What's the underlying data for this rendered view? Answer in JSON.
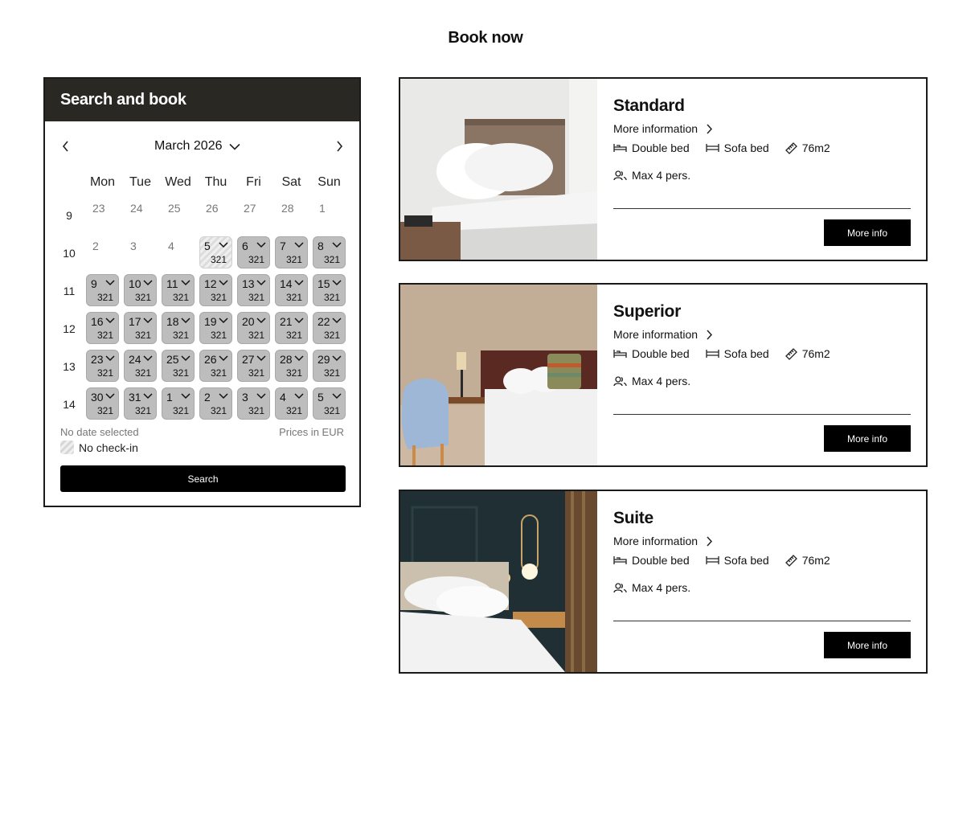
{
  "page": {
    "title": "Book now"
  },
  "widget": {
    "title": "Search and book",
    "month": "March 2026",
    "weekdays": [
      "Mon",
      "Tue",
      "Wed",
      "Thu",
      "Fri",
      "Sat",
      "Sun"
    ],
    "weeks": [
      {
        "num": "9",
        "days": [
          {
            "d": "23",
            "state": "plain"
          },
          {
            "d": "24",
            "state": "plain"
          },
          {
            "d": "25",
            "state": "plain"
          },
          {
            "d": "26",
            "state": "plain"
          },
          {
            "d": "27",
            "state": "plain"
          },
          {
            "d": "28",
            "state": "plain"
          },
          {
            "d": "1",
            "state": "plain"
          }
        ]
      },
      {
        "num": "10",
        "days": [
          {
            "d": "2",
            "state": "plain"
          },
          {
            "d": "3",
            "state": "plain"
          },
          {
            "d": "4",
            "state": "plain"
          },
          {
            "d": "5",
            "state": "no-checkin",
            "price": "321"
          },
          {
            "d": "6",
            "state": "available",
            "price": "321"
          },
          {
            "d": "7",
            "state": "available",
            "price": "321"
          },
          {
            "d": "8",
            "state": "available",
            "price": "321"
          }
        ]
      },
      {
        "num": "11",
        "days": [
          {
            "d": "9",
            "state": "available",
            "price": "321"
          },
          {
            "d": "10",
            "state": "available",
            "price": "321"
          },
          {
            "d": "11",
            "state": "available",
            "price": "321"
          },
          {
            "d": "12",
            "state": "available",
            "price": "321"
          },
          {
            "d": "13",
            "state": "available",
            "price": "321"
          },
          {
            "d": "14",
            "state": "available",
            "price": "321"
          },
          {
            "d": "15",
            "state": "available",
            "price": "321"
          }
        ]
      },
      {
        "num": "12",
        "days": [
          {
            "d": "16",
            "state": "available",
            "price": "321"
          },
          {
            "d": "17",
            "state": "available",
            "price": "321"
          },
          {
            "d": "18",
            "state": "available",
            "price": "321"
          },
          {
            "d": "19",
            "state": "available",
            "price": "321"
          },
          {
            "d": "20",
            "state": "available",
            "price": "321"
          },
          {
            "d": "21",
            "state": "available",
            "price": "321"
          },
          {
            "d": "22",
            "state": "available",
            "price": "321"
          }
        ]
      },
      {
        "num": "13",
        "days": [
          {
            "d": "23",
            "state": "available",
            "price": "321"
          },
          {
            "d": "24",
            "state": "available",
            "price": "321"
          },
          {
            "d": "25",
            "state": "available",
            "price": "321"
          },
          {
            "d": "26",
            "state": "available",
            "price": "321"
          },
          {
            "d": "27",
            "state": "available",
            "price": "321"
          },
          {
            "d": "28",
            "state": "available",
            "price": "321"
          },
          {
            "d": "29",
            "state": "available",
            "price": "321"
          }
        ]
      },
      {
        "num": "14",
        "days": [
          {
            "d": "30",
            "state": "available",
            "price": "321"
          },
          {
            "d": "31",
            "state": "available",
            "price": "321"
          },
          {
            "d": "1",
            "state": "available",
            "price": "321"
          },
          {
            "d": "2",
            "state": "available",
            "price": "321"
          },
          {
            "d": "3",
            "state": "available",
            "price": "321"
          },
          {
            "d": "4",
            "state": "available",
            "price": "321"
          },
          {
            "d": "5",
            "state": "available",
            "price": "321"
          }
        ]
      }
    ],
    "status": "No date selected",
    "currency_note": "Prices in EUR",
    "legend_no_checkin": "No check-in",
    "search_label": "Search"
  },
  "rooms": [
    {
      "name": "Standard",
      "more_information": "More information",
      "bed": "Double bed",
      "sofa": "Sofa bed",
      "area": "76m2",
      "max": "Max 4 pers.",
      "button": "More info"
    },
    {
      "name": "Superior",
      "more_information": "More information",
      "bed": "Double bed",
      "sofa": "Sofa bed",
      "area": "76m2",
      "max": "Max 4 pers.",
      "button": "More info"
    },
    {
      "name": "Suite",
      "more_information": "More information",
      "bed": "Double bed",
      "sofa": "Sofa bed",
      "area": "76m2",
      "max": "Max 4 pers.",
      "button": "More info"
    }
  ],
  "icons": {
    "prev": "chevron-left-icon",
    "next": "chevron-right-icon",
    "month": "chevron-down-icon",
    "bed": "bed-icon",
    "sofa": "sofa-bed-icon",
    "area": "ruler-icon",
    "guests": "users-icon"
  }
}
